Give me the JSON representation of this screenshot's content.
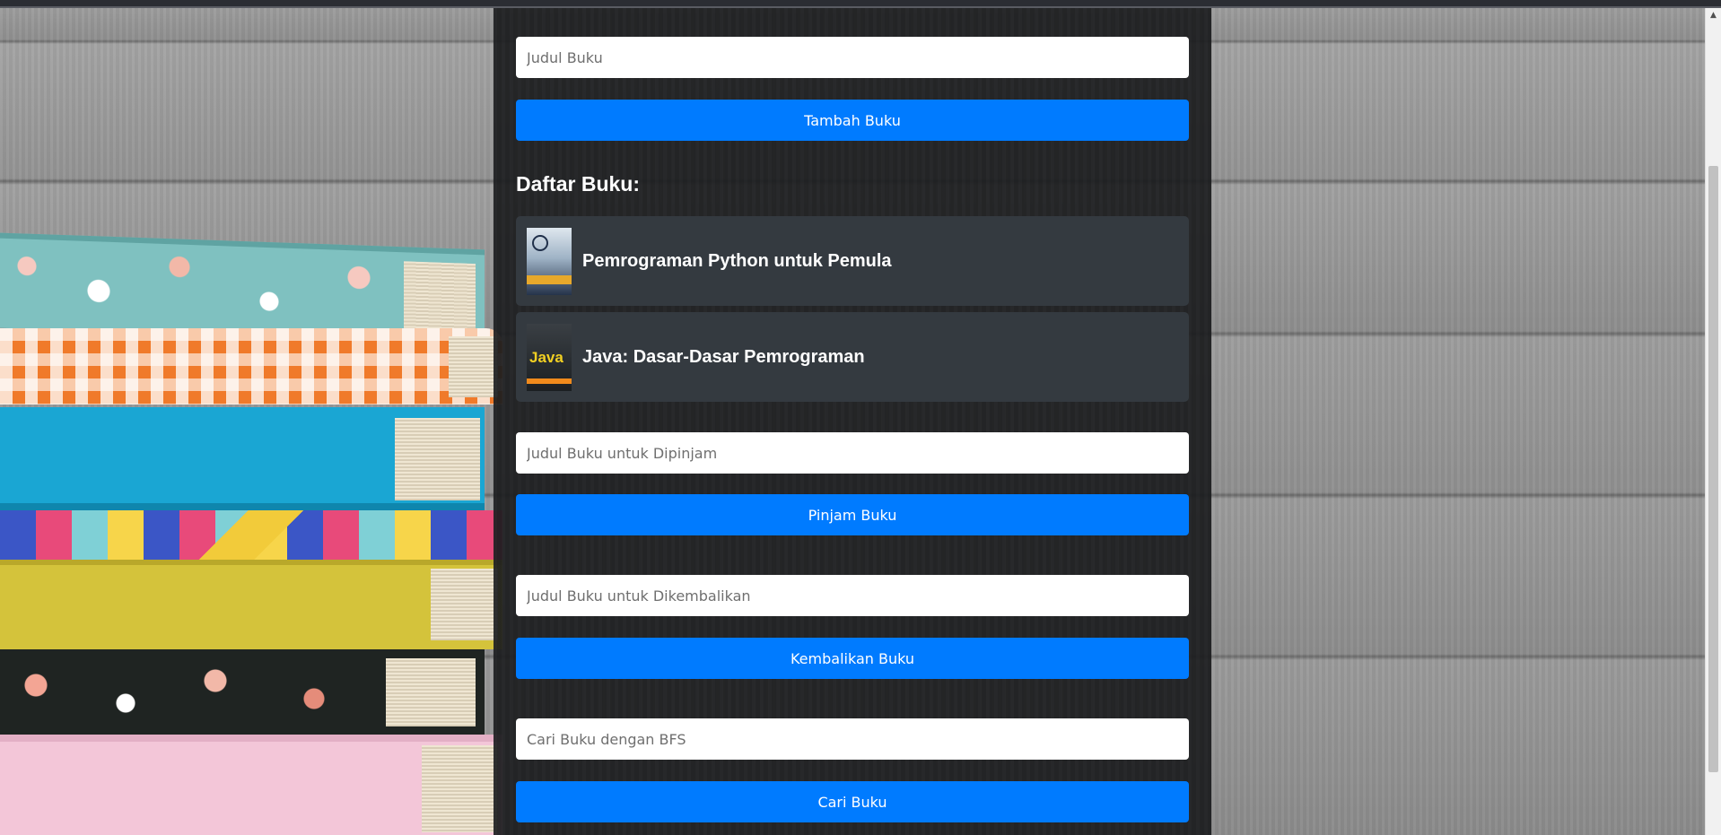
{
  "form": {
    "title_placeholder": "Judul Buku",
    "add_button": "Tambah Buku"
  },
  "book_list": {
    "heading": "Daftar Buku:",
    "items": [
      {
        "title": "Pemrograman Python untuk Pemula",
        "cover_text": ""
      },
      {
        "title": "Java: Dasar-Dasar Pemrograman",
        "cover_text": "Java"
      }
    ]
  },
  "borrow": {
    "placeholder": "Judul Buku untuk Dipinjam",
    "button": "Pinjam Buku"
  },
  "return_book": {
    "placeholder": "Judul Buku untuk Dikembalikan",
    "button": "Kembalikan Buku"
  },
  "search": {
    "placeholder": "Cari Buku dengan BFS",
    "button": "Cari Buku"
  },
  "colors": {
    "button": "#007bff",
    "panel": "#1c1d1f",
    "card": "#343a40"
  },
  "icons": {
    "scroll_up": "chevron-up-icon"
  }
}
